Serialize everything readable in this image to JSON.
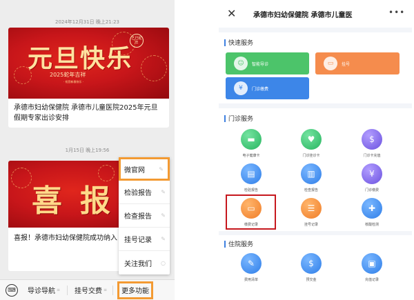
{
  "left": {
    "timestamp1": "2024年12月31日 晚上21:23",
    "banner1": {
      "title": "元旦快乐",
      "subtitle": "2025蛇年吉祥",
      "small": "· 祝您新春快乐 ·",
      "badge": "乙巳蛇年"
    },
    "article1_text": "承德市妇幼保健院 承德市儿童医院2025年元旦假期专家出诊安排",
    "timestamp2": "1月15日 晚上19:56",
    "banner2": {
      "title": "喜报"
    },
    "article2_text": "喜报！承德市妇幼保健院成功纳入 健院管理",
    "menu_items": [
      "微官网",
      "检验报告",
      "检查报告",
      "挂号记录",
      "关注我们"
    ],
    "tabs": [
      "导诊导航",
      "挂号交费",
      "更多功能"
    ]
  },
  "right": {
    "title": "承德市妇幼保健院 承德市儿童医",
    "more": "•••",
    "quick_section": "快速服务",
    "quick_buttons": [
      {
        "label": "智能导诊",
        "color": "#4cc46a"
      },
      {
        "label": "挂号",
        "color": "#f58c4d"
      },
      {
        "label": "门诊缴费",
        "color": "#3d86e8"
      }
    ],
    "outpatient_section": "门诊服务",
    "outpatient_items": [
      {
        "label": "电子健康卡",
        "icon": "card-icon",
        "color": "green"
      },
      {
        "label": "门诊挂诊卡",
        "icon": "heart-icon",
        "color": "green"
      },
      {
        "label": "门诊卡充值",
        "icon": "money-icon",
        "color": "purple"
      },
      {
        "label": "检验报告",
        "icon": "report-icon",
        "color": "blue"
      },
      {
        "label": "检查报告",
        "icon": "doc-icon",
        "color": "blue"
      },
      {
        "label": "门诊缴费",
        "icon": "pay-icon",
        "color": "purple"
      },
      {
        "label": "缴费记录",
        "icon": "receipt-icon",
        "color": "orange"
      },
      {
        "label": "挂号记录",
        "icon": "list-icon",
        "color": "orange"
      },
      {
        "label": "核酸检测",
        "icon": "test-icon",
        "color": "blue"
      }
    ],
    "inpatient_section": "住院服务",
    "inpatient_items": [
      {
        "label": "费用清单",
        "icon": "bill-icon",
        "color": "blue"
      },
      {
        "label": "预交金",
        "icon": "deposit-icon",
        "color": "blue"
      },
      {
        "label": "充值记录",
        "icon": "wallet-icon",
        "color": "blue"
      }
    ]
  }
}
